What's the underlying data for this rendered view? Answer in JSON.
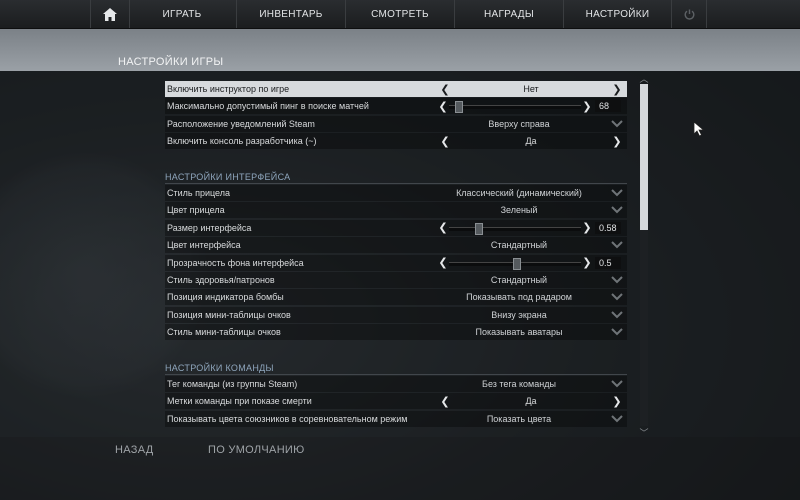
{
  "nav": {
    "tabs": [
      "ИГРАТЬ",
      "ИНВЕНТАРЬ",
      "СМОТРЕТЬ",
      "НАГРАДЫ",
      "НАСТРОЙКИ"
    ]
  },
  "page_title": "НАСТРОЙКИ ИГРЫ",
  "game_settings": [
    {
      "label": "Включить инструктор по игре",
      "type": "arrows",
      "value": "Нет",
      "highlight": true
    },
    {
      "label": "Максимально допустимый пинг в поиске матчей",
      "type": "slider",
      "value": "68",
      "fraction": 0.05
    },
    {
      "label": "Расположение уведомлений Steam",
      "type": "dropdown",
      "value": "Вверху справа"
    },
    {
      "label": "Включить консоль разработчика (~)",
      "type": "arrows",
      "value": "Да"
    }
  ],
  "interface_section": "НАСТРОЙКИ ИНТЕРФЕЙСА",
  "interface_settings": [
    {
      "label": "Стиль прицела",
      "type": "dropdown",
      "value": "Классический (динамический)"
    },
    {
      "label": "Цвет прицела",
      "type": "dropdown",
      "value": "Зеленый"
    },
    {
      "label": "Размер интерфейса",
      "type": "slider",
      "value": "0.58",
      "fraction": 0.2
    },
    {
      "label": "Цвет интерфейса",
      "type": "dropdown",
      "value": "Стандартный"
    },
    {
      "label": "Прозрачность фона интерфейса",
      "type": "slider",
      "value": "0.5",
      "fraction": 0.5
    },
    {
      "label": "Стиль здоровья/патронов",
      "type": "dropdown",
      "value": "Стандартный"
    },
    {
      "label": "Позиция индикатора бомбы",
      "type": "dropdown",
      "value": "Показывать под радаром"
    },
    {
      "label": "Позиция мини-таблицы очков",
      "type": "dropdown",
      "value": "Внизу экрана"
    },
    {
      "label": "Стиль мини-таблицы очков",
      "type": "dropdown",
      "value": "Показывать аватары"
    }
  ],
  "team_section": "НАСТРОЙКИ КОМАНДЫ",
  "team_settings": [
    {
      "label": "Тег команды (из группы Steam)",
      "type": "dropdown",
      "value": "Без тега команды"
    },
    {
      "label": "Метки команды при показе смерти",
      "type": "arrows",
      "value": "Да"
    },
    {
      "label": "Показывать цвета союзников в соревновательном режим",
      "type": "dropdown",
      "value": "Показать цвета"
    }
  ],
  "footer": {
    "back": "НАЗАД",
    "defaults": "ПО УМОЛЧАНИЮ"
  },
  "icons": {
    "home": "home-icon",
    "power": "power-icon",
    "cursor": "mouse-cursor-icon"
  },
  "colors": {
    "section_heading": "#8fa6bd",
    "highlight_row": "#d7dadd",
    "header_band": "#8a9096"
  }
}
